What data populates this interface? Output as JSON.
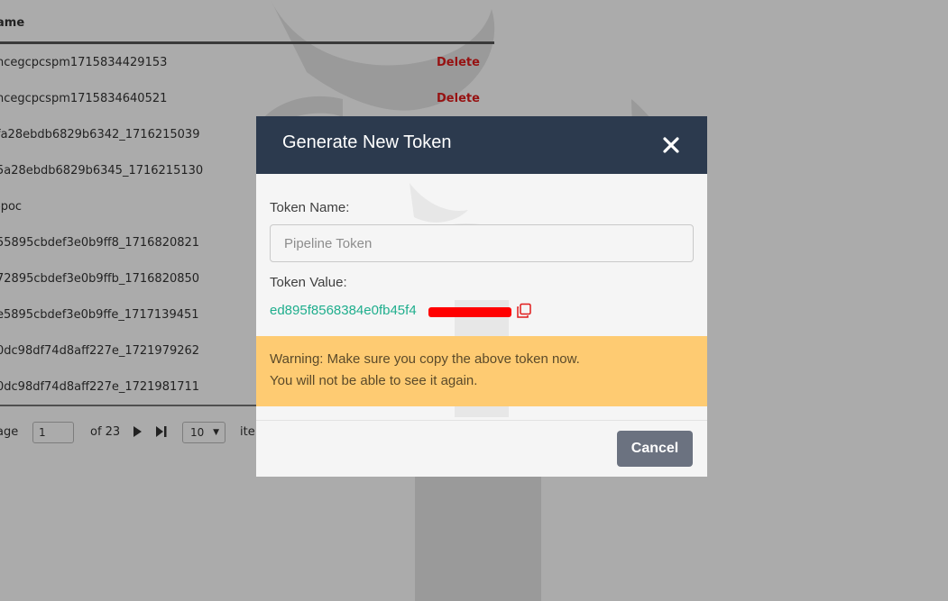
{
  "background": {
    "table": {
      "header_name": "ame",
      "rows": [
        {
          "name": "ncegcpcspm1715834429153",
          "action": "Delete"
        },
        {
          "name": "ncegcpcspm1715834640521",
          "action": "Delete"
        },
        {
          "name": "fa28ebdb6829b6342_1716215039",
          "action": ""
        },
        {
          "name": "5a28ebdb6829b6345_1716215130",
          "action": ""
        },
        {
          "name": "-poc",
          "action": ""
        },
        {
          "name": "55895cbdef3e0b9ff8_1716820821",
          "action": ""
        },
        {
          "name": "72895cbdef3e0b9ffb_1716820850",
          "action": ""
        },
        {
          "name": "e5895cbdef3e0b9ffe_1717139451",
          "action": ""
        },
        {
          "name": "0dc98df74d8aff227e_1721979262",
          "action": ""
        },
        {
          "name": "0dc98df74d8aff227e_1721981711",
          "action": ""
        }
      ]
    },
    "pager": {
      "label": "age",
      "current_page": "1",
      "of_text": "of 23",
      "page_size": "10",
      "items_label": "ite"
    }
  },
  "modal": {
    "title": "Generate New Token",
    "token_name_label": "Token Name:",
    "token_name_value": "Pipeline Token",
    "token_value_label": "Token Value:",
    "token_value": "ed895f8568384e0fb45f4",
    "warning_line1": "Warning: Make sure you copy the above token now.",
    "warning_line2": "You will not be able to see it again.",
    "cancel_label": "Cancel"
  },
  "colors": {
    "modal_header": "#2c3a4e",
    "warning_bg": "#fecb72",
    "token_text": "#1fae8d",
    "cancel_bg": "#6b7280",
    "delete_text": "#e01b1b",
    "redaction": "#ff0000"
  },
  "icons": {
    "close": "close-icon",
    "copy": "copy-icon",
    "next_page": "play-icon",
    "last_page": "skip-end-icon"
  }
}
